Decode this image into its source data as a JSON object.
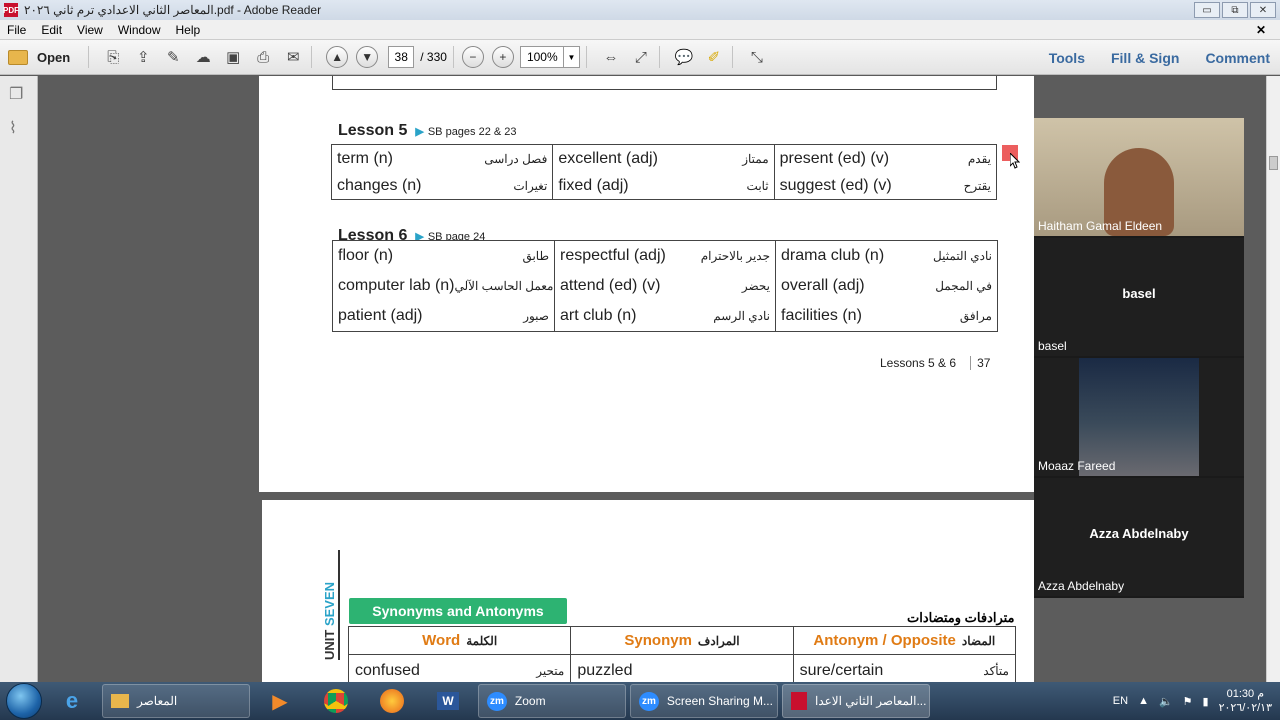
{
  "window": {
    "title": "المعاصر الثاني الاعدادي ترم ثاني ٢٠٢٦.pdf - Adobe Reader",
    "pdf_icon_label": "PDF",
    "minimize": "▭",
    "restore": "⧉",
    "close": "✕"
  },
  "menu": {
    "items": [
      "File",
      "Edit",
      "View",
      "Window",
      "Help"
    ],
    "close": "✕"
  },
  "toolbar": {
    "open_label": "Open",
    "page_current": "38",
    "page_total": "/ 330",
    "zoom": "100%",
    "links": [
      "Tools",
      "Fill & Sign",
      "Comment"
    ]
  },
  "page1": {
    "lesson5": {
      "title": "Lesson",
      "number": "5",
      "sb": "SB pages 22 & 23",
      "columns": [
        [
          {
            "en": "term (n)",
            "ar": "فصل دراسى"
          },
          {
            "en": "changes (n)",
            "ar": "تغيرات"
          }
        ],
        [
          {
            "en": "excellent (adj)",
            "ar": "ممتاز"
          },
          {
            "en": "fixed (adj)",
            "ar": "ثابت"
          }
        ],
        [
          {
            "en": "present (ed) (v)",
            "ar": "يقدم"
          },
          {
            "en": "suggest (ed) (v)",
            "ar": "يقترح"
          }
        ]
      ]
    },
    "lesson6": {
      "title": "Lesson",
      "number": "6",
      "sb": "SB page 24",
      "columns": [
        [
          {
            "en": "floor (n)",
            "ar": "طابق"
          },
          {
            "en": "computer lab (n)",
            "ar": "معمل الحاسب الآلي"
          },
          {
            "en": "patient (adj)",
            "ar": "صبور"
          }
        ],
        [
          {
            "en": "respectful (adj)",
            "ar": "جدير بالاحترام"
          },
          {
            "en": "attend (ed) (v)",
            "ar": "يحضر"
          },
          {
            "en": "art club (n)",
            "ar": "نادي الرسم"
          }
        ],
        [
          {
            "en": "drama club (n)",
            "ar": "نادي التمثيل"
          },
          {
            "en": "overall (adj)",
            "ar": "في المجمل"
          },
          {
            "en": "facilities (n)",
            "ar": "مرافق"
          }
        ]
      ]
    },
    "footer_text": "Lessons 5 & 6",
    "footer_page": "37"
  },
  "page2": {
    "unit_prefix": "UNIT ",
    "unit_name": "SEVEN",
    "banner": "Synonyms and Antonyms",
    "banner_ar": "مترادفات ومتضادات",
    "headers": [
      {
        "en": "Word",
        "ar": "الكلمة"
      },
      {
        "en": "Synonym",
        "ar": "المرادف"
      },
      {
        "en": "Antonym / Opposite",
        "ar": "المضاد"
      }
    ],
    "row1": [
      {
        "en": "confused",
        "ar": "متحير"
      },
      {
        "en": "puzzled",
        "ar": ""
      },
      {
        "en": "sure/certain",
        "ar": "متأكد"
      }
    ]
  },
  "participants": [
    {
      "name": "Haitham Gamal Eldeen",
      "video": true
    },
    {
      "name": "basel",
      "center": "basel",
      "video": false
    },
    {
      "name": "Moaaz Fareed",
      "video": true
    },
    {
      "name": "Azza Abdelnaby",
      "center": "Azza Abdelnaby",
      "video": false
    }
  ],
  "taskbar": {
    "apps": [
      {
        "label": "المعاصر"
      },
      {
        "label": "Zoom"
      },
      {
        "label": "Screen Sharing M..."
      },
      {
        "label": "المعاصر الثاني الاعدا..."
      }
    ],
    "zoom_badge": "zm",
    "word_badge": "W",
    "lang": "EN",
    "time": "01:30 م",
    "date": "٢٠٢٦/٠٢/١٣"
  }
}
